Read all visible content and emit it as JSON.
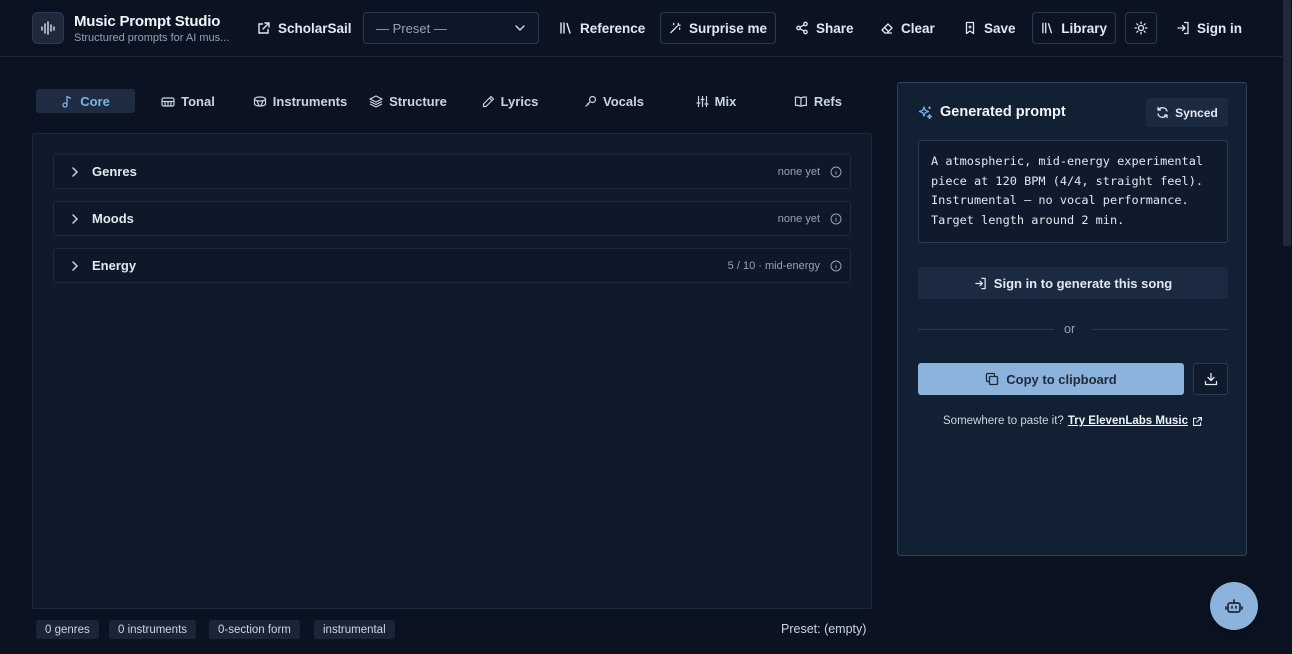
{
  "header": {
    "title": "Music Prompt Studio",
    "subtitle": "Structured prompts for AI mus...",
    "scholarsail_label": "ScholarSail",
    "preset_placeholder": "— Preset —",
    "reference_label": "Reference",
    "surprise_label": "Surprise me",
    "share_label": "Share",
    "clear_label": "Clear",
    "save_label": "Save",
    "library_label": "Library",
    "signin_label": "Sign in"
  },
  "tabs": [
    {
      "label": "Core",
      "icon": "music-note-icon",
      "active": true
    },
    {
      "label": "Tonal",
      "icon": "piano-icon",
      "active": false
    },
    {
      "label": "Instruments",
      "icon": "drum-icon",
      "active": false
    },
    {
      "label": "Structure",
      "icon": "layers-icon",
      "active": false
    },
    {
      "label": "Lyrics",
      "icon": "pen-icon",
      "active": false
    },
    {
      "label": "Vocals",
      "icon": "mic-icon",
      "active": false
    },
    {
      "label": "Mix",
      "icon": "sliders-icon",
      "active": false
    },
    {
      "label": "Refs",
      "icon": "book-icon",
      "active": false
    }
  ],
  "sections": [
    {
      "title": "Genres",
      "value": "none yet"
    },
    {
      "title": "Moods",
      "value": "none yet"
    },
    {
      "title": "Energy",
      "value": "5 / 10 · mid-energy"
    }
  ],
  "footer": {
    "chips": [
      "0 genres",
      "0 instruments",
      "0-section form",
      "instrumental"
    ],
    "preset_status": "Preset: (empty)"
  },
  "prompt_panel": {
    "title": "Generated prompt",
    "synced_label": "Synced",
    "prompt_text": "A atmospheric, mid-energy experimental piece at 120 BPM (4/4, straight feel). Instrumental — no vocal performance. Target length around 2 min.",
    "signin_generate_label": "Sign in to generate this song",
    "or_label": "or",
    "copy_label": "Copy to clipboard",
    "paste_text": "Somewhere to paste it?",
    "paste_link": "Try ElevenLabs Music"
  },
  "colors": {
    "background": "#0b1322",
    "accent": "#8bb3dc",
    "active_tab_text": "#7fb3e6"
  }
}
